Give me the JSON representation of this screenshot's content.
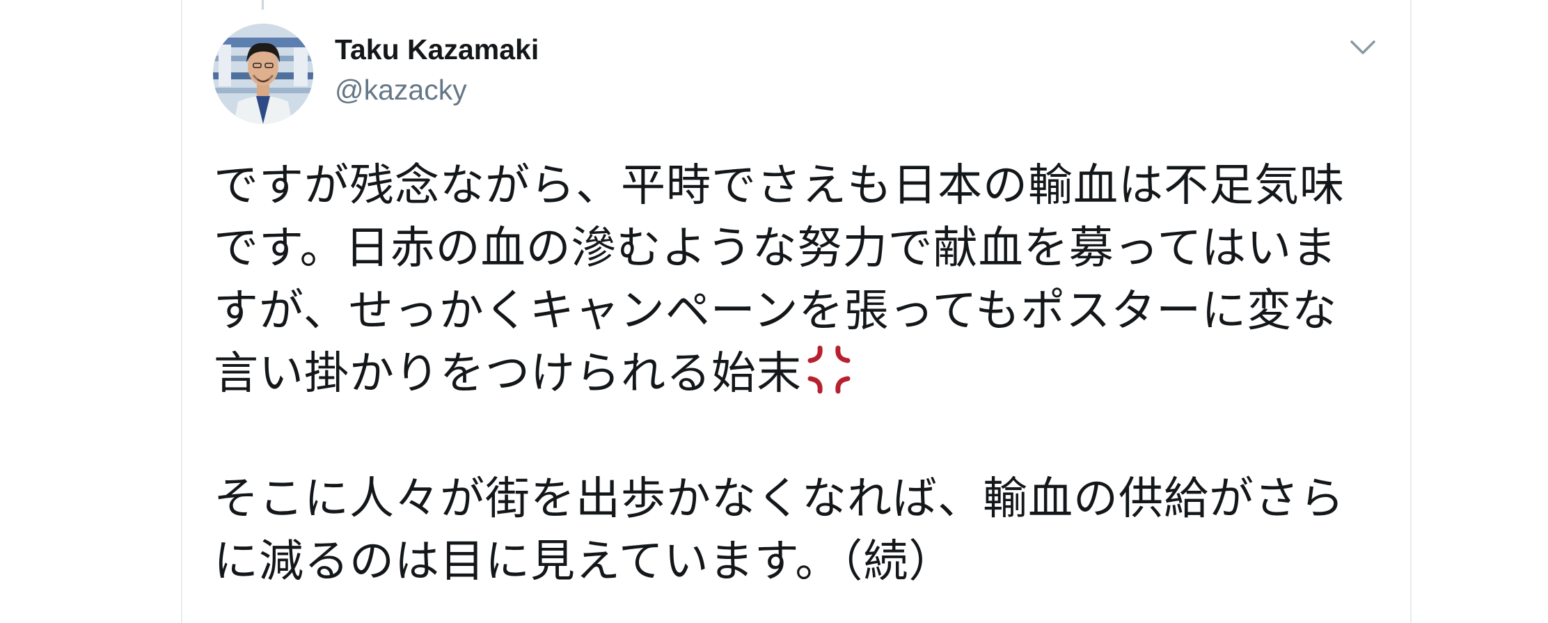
{
  "author": {
    "display_name": "Taku Kazamaki",
    "handle": "@kazacky"
  },
  "tweet": {
    "paragraph1": "ですが残念ながら、平時でさえも日本の輸血は不足気味です。日赤の血の滲むような努力で献血を募ってはいますが、せっかくキャンペーンを張ってもポスターに変な言い掛かりをつけられる始末",
    "paragraph2": "そこに人々が街を出歩かなくなれば、輸血の供給がさらに減るのは目に見えています。（続）"
  },
  "icons": {
    "menu": "chevron-down-icon",
    "emoji": "anger-symbol-icon"
  },
  "colors": {
    "text_primary": "#14171a",
    "text_secondary": "#657786",
    "border": "#e6ecf0",
    "anger_red": "#b7212f"
  }
}
